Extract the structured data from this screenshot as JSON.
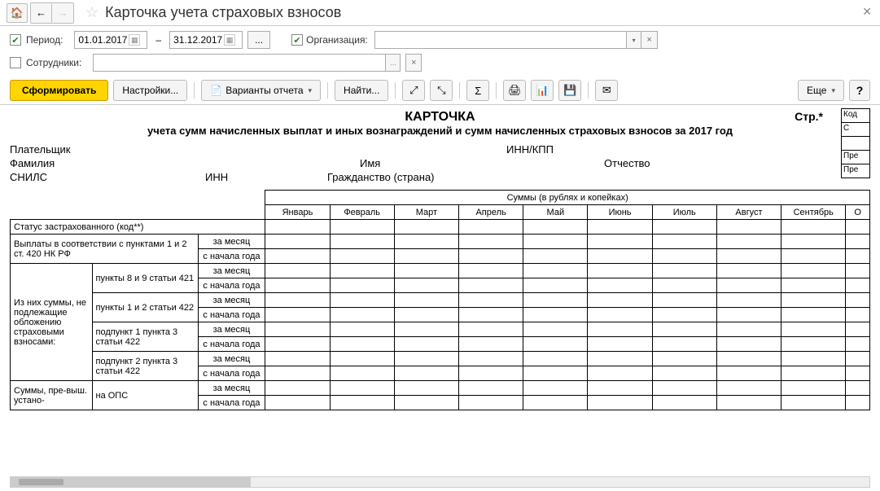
{
  "title": "Карточка учета страховых взносов",
  "filters": {
    "period_label": "Период:",
    "date_from": "01.01.2017",
    "date_to": "31.12.2017",
    "dots": "...",
    "org_label": "Организация:",
    "org_value": "",
    "employees_label": "Сотрудники:",
    "employees_value": ""
  },
  "toolbar": {
    "generate": "Сформировать",
    "settings": "Настройки...",
    "variants": "Варианты отчета",
    "find": "Найти...",
    "more": "Еще",
    "help": "?"
  },
  "report": {
    "title": "КАРТОЧКА",
    "subtitle": "учета сумм начисленных выплат и иных вознаграждений и сумм начисленных страховых взносов за 2017 год",
    "page_label": "Стр.*",
    "side": {
      "c1": "Код",
      "c2": "С",
      "c3": "",
      "c4": "Пре",
      "c5": "Пре"
    },
    "info": {
      "payer": "Плательщик",
      "surname": "Фамилия",
      "name": "Имя",
      "snils": "СНИЛС",
      "inn": "ИНН",
      "citizenship": "Гражданство (страна)",
      "innkpp": "ИНН/КПП",
      "patronymic": "Отчество"
    },
    "months_header": "Суммы (в рублях и копейках)",
    "months": [
      "Январь",
      "Февраль",
      "Март",
      "Апрель",
      "Май",
      "Июнь",
      "Июль",
      "Август",
      "Сентябрь",
      "О"
    ],
    "status_row": "Статус застрахованного (код**)",
    "per_month": "за месяц",
    "from_year": "с начала года",
    "rows": {
      "r1": "Выплаты в соответствии с пунктами 1 и 2 ст. 420 НК РФ",
      "grp": "Из них суммы, не подлежащие обложению страховыми взносами:",
      "r2": "пункты 8 и 9 статьи 421",
      "r3": "пункты 1 и 2 статьи 422",
      "r4": "подпункт 1 пункта 3 статьи 422",
      "r5": "подпункт 2 пункта 3 статьи 422",
      "grp2": "Суммы, пре-выш. устано-",
      "r6": "на ОПС"
    }
  }
}
